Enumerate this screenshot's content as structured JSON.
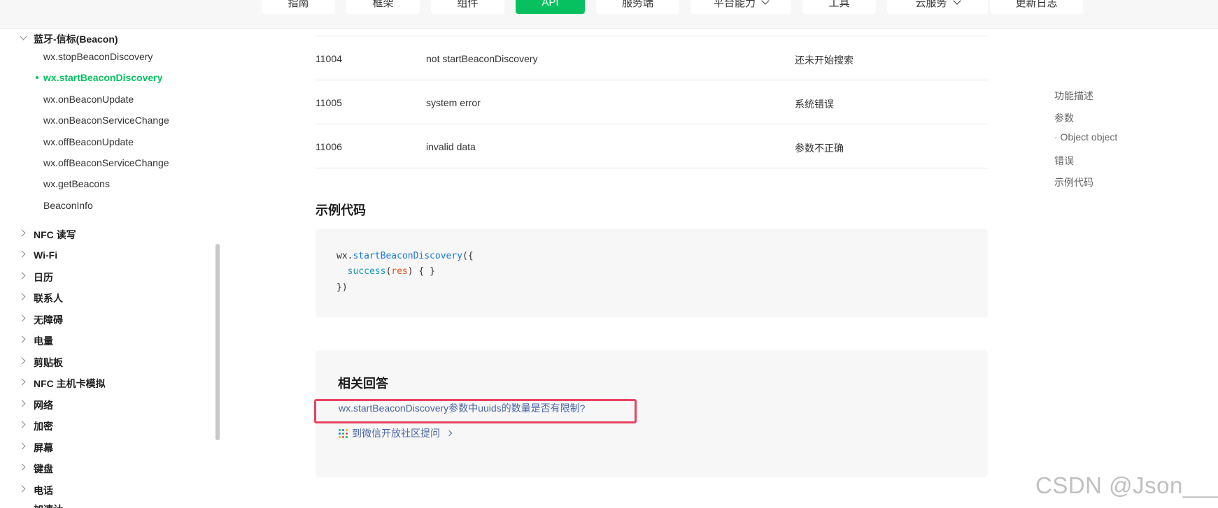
{
  "nav": {
    "tabs": [
      {
        "label": "指南",
        "has_dropdown": false
      },
      {
        "label": "框架",
        "has_dropdown": false
      },
      {
        "label": "组件",
        "has_dropdown": false
      },
      {
        "label": "API",
        "has_dropdown": false,
        "active": true
      },
      {
        "label": "服务端",
        "has_dropdown": false
      },
      {
        "label": "平台能力",
        "has_dropdown": true
      },
      {
        "label": "工具",
        "has_dropdown": false
      },
      {
        "label": "云服务",
        "has_dropdown": true
      },
      {
        "label": "更新日志",
        "has_dropdown": false
      }
    ]
  },
  "sidebar": {
    "group_title": "蓝牙-信标(Beacon)",
    "sub_items": [
      {
        "label": "wx.stopBeaconDiscovery"
      },
      {
        "label": "wx.startBeaconDiscovery",
        "active": true
      },
      {
        "label": "wx.onBeaconUpdate"
      },
      {
        "label": "wx.onBeaconServiceChange"
      },
      {
        "label": "wx.offBeaconUpdate"
      },
      {
        "label": "wx.offBeaconServiceChange"
      },
      {
        "label": "wx.getBeacons"
      },
      {
        "label": "BeaconInfo"
      }
    ],
    "groups": [
      {
        "label": "NFC 读写"
      },
      {
        "label": "Wi-Fi"
      },
      {
        "label": "日历"
      },
      {
        "label": "联系人"
      },
      {
        "label": "无障碍"
      },
      {
        "label": "电量"
      },
      {
        "label": "剪贴板"
      },
      {
        "label": "NFC 主机卡模拟"
      },
      {
        "label": "网络"
      },
      {
        "label": "加密"
      },
      {
        "label": "屏幕"
      },
      {
        "label": "键盘"
      },
      {
        "label": "电话"
      },
      {
        "label": "加速计"
      }
    ]
  },
  "error_table": {
    "rows": [
      {
        "code": "11004",
        "message": "not startBeaconDiscovery",
        "description": "还未开始搜索"
      },
      {
        "code": "11005",
        "message": "system error",
        "description": "系统错误"
      },
      {
        "code": "11006",
        "message": "invalid data",
        "description": "参数不正确"
      }
    ]
  },
  "example": {
    "title": "示例代码",
    "code": {
      "line1_obj": "wx.",
      "line1_fn": "startBeaconDiscovery",
      "line1_tail": "({",
      "line2_indent": "  ",
      "line2_prop": "success",
      "line2_open": "(",
      "line2_arg": "res",
      "line2_tail": ") { }",
      "line3": "})"
    }
  },
  "related": {
    "title": "相关回答",
    "question": "wx.startBeaconDiscovery参数中uuids的数量是否有限制?",
    "community_link": "到微信开放社区提问"
  },
  "toc": {
    "items": [
      {
        "label": "功能描述"
      },
      {
        "label": "参数"
      },
      {
        "label": "· Object object"
      },
      {
        "label": "错误"
      },
      {
        "label": "示例代码"
      }
    ]
  },
  "watermark": "CSDN @Json_____",
  "colors": {
    "accent": "#07c160",
    "link": "#4a64a8",
    "highlight_border": "#e8445f"
  }
}
